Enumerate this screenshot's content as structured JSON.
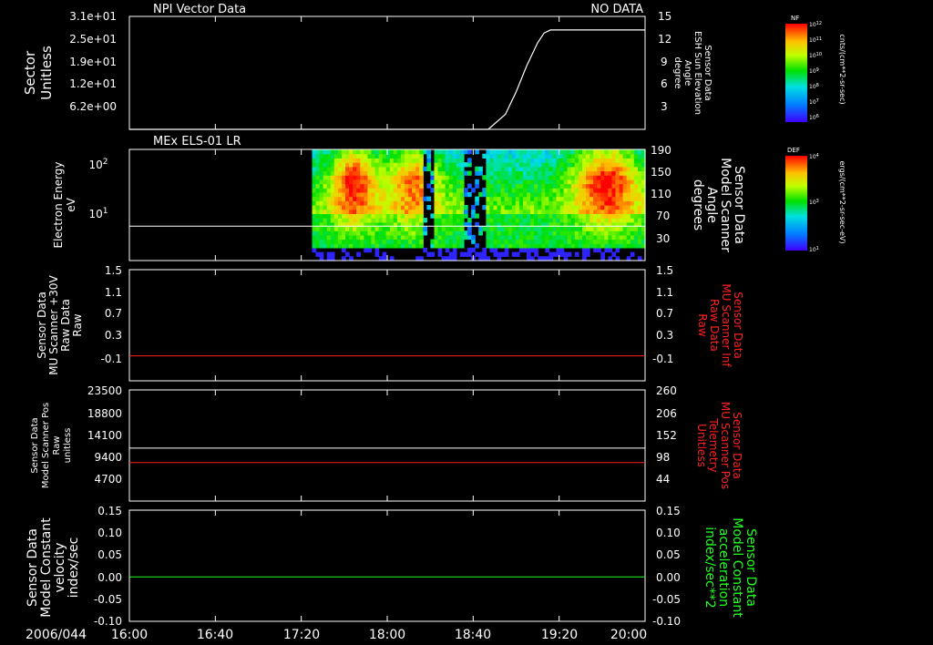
{
  "time_axis": {
    "date_label": "2006/044",
    "ticks": [
      "16:00",
      "16:40",
      "17:20",
      "18:00",
      "18:40",
      "19:20",
      "20:00"
    ]
  },
  "colors": {
    "background": "#000000",
    "foreground": "#ffffff",
    "red_trace": "#ff2020",
    "green_trace": "#20ff20",
    "white_trace": "#ffffff"
  },
  "colorbars": [
    {
      "name": "NF",
      "label": "NF",
      "unit_label": "cnts/(cm**2-sr-sec)",
      "tick_labels": [
        "10^12",
        "10^11",
        "10^10",
        "10^9",
        "10^8",
        "10^7",
        "10^6"
      ],
      "ticks": [
        {
          "mant": "10",
          "exp": "12"
        },
        {
          "mant": "10",
          "exp": "11"
        },
        {
          "mant": "10",
          "exp": "10"
        },
        {
          "mant": "10",
          "exp": "9"
        },
        {
          "mant": "10",
          "exp": "8"
        },
        {
          "mant": "10",
          "exp": "7"
        },
        {
          "mant": "10",
          "exp": "6"
        }
      ]
    },
    {
      "name": "DEF",
      "label": "DEF",
      "unit_label": "ergs/(cm**2-sr-sec-eV)",
      "tick_labels": [
        "10^4",
        "10^3",
        "10^1"
      ],
      "ticks": [
        {
          "mant": "10",
          "exp": "4"
        },
        {
          "mant": "10",
          "exp": "3"
        },
        {
          "mant": "10",
          "exp": "1"
        }
      ]
    }
  ],
  "chart_data": [
    {
      "type": "line",
      "title": "NPI Vector Data",
      "status_text": "NO DATA",
      "ylabel_left": [
        "Sector",
        "Unitless"
      ],
      "yticks_left": [
        "3.1e+01",
        "2.5e+01",
        "1.9e+01",
        "1.2e+01",
        "6.2e+00"
      ],
      "ylabel_right": [
        "Sensor Data",
        "ESH Sun Elevation",
        "Angle",
        "degree"
      ],
      "yticks_right": [
        "15",
        "12",
        "9",
        "6",
        "3"
      ],
      "ylim_right": [
        0,
        15
      ],
      "series": [
        {
          "color": "#ffffff",
          "axis": "right",
          "x": [
            "16:00",
            "18:47",
            "18:55",
            "19:00",
            "19:05",
            "19:10",
            "19:13",
            "19:16",
            "20:00"
          ],
          "values": [
            0,
            0,
            2,
            5,
            8.5,
            11.5,
            12.8,
            13.2,
            13.2
          ]
        }
      ]
    },
    {
      "type": "heatmap",
      "title": "MEx ELS-01 LR",
      "ylabel_left": [
        "Electron Energy",
        "eV"
      ],
      "ytick_left_labels": [
        "10^2",
        "10^1"
      ],
      "ylim_left": [
        4,
        180
      ],
      "ylog_left": true,
      "yticks_left": [
        {
          "mant": "10",
          "exp": "2",
          "value": 100
        },
        {
          "mant": "10",
          "exp": "1",
          "value": 10
        }
      ],
      "ylabel_right": [
        "Sensor Data",
        "Model Scanner",
        "Angle",
        "degrees"
      ],
      "yticks_right": [
        "190",
        "150",
        "110",
        "70",
        "30"
      ],
      "ylim_right": [
        0,
        190
      ],
      "data_coverage": [
        "17:25",
        "20:00"
      ],
      "horizontal_line": {
        "value_eV": 13,
        "color": "#ffffff"
      },
      "colorbar": "DEF"
    },
    {
      "type": "line",
      "ylabel_left": [
        "Sensor Data",
        "MU Scanner +30V",
        "Raw Data",
        "Raw"
      ],
      "yticks_left": [
        "1.5",
        "1.1",
        "0.7",
        "0.3",
        "-0.1"
      ],
      "ylim_left": [
        -0.5,
        1.5
      ],
      "ylabel_right": [
        "Sensor Data",
        "MU Scanner Inf",
        "Raw Data",
        "Raw"
      ],
      "yticks_right": [
        "1.5",
        "1.1",
        "0.7",
        "0.3",
        "-0.1"
      ],
      "series": [
        {
          "color": "#ff2020",
          "x": [
            "16:00",
            "20:00"
          ],
          "values": [
            -0.05,
            -0.05
          ]
        }
      ]
    },
    {
      "type": "line",
      "ylabel_left": [
        "Sensor Data",
        "Model Scanner Pos",
        "Raw",
        "unitless"
      ],
      "yticks_left": [
        "23500",
        "18800",
        "14100",
        "9400",
        "4700"
      ],
      "ylim_left": [
        0,
        23500
      ],
      "ylabel_right": [
        "Sensor Data",
        "MU Scanner Pos",
        "Telemetry",
        "Unitless"
      ],
      "yticks_right": [
        "260",
        "206",
        "152",
        "98",
        "44"
      ],
      "ylim_right": [
        -10,
        260
      ],
      "series": [
        {
          "color": "#ffffff",
          "axis": "left",
          "x": [
            "16:00",
            "20:00"
          ],
          "values": [
            11200,
            11200
          ]
        },
        {
          "color": "#ff2020",
          "axis": "left",
          "x": [
            "16:00",
            "20:00"
          ],
          "values": [
            8150,
            8150
          ]
        }
      ]
    },
    {
      "type": "line",
      "ylabel_left": [
        "Sensor Data",
        "Model Constant",
        "velocity",
        "index/sec"
      ],
      "yticks_left": [
        "0.15",
        "0.10",
        "0.05",
        "0.00",
        "-0.05",
        "-0.10"
      ],
      "ylim_left": [
        -0.1,
        0.15
      ],
      "ylabel_right": [
        "Sensor Data",
        "Model Constant",
        "acceleration",
        "index/sec**2"
      ],
      "yticks_right": [
        "0.15",
        "0.10",
        "0.05",
        "0.00",
        "-0.05",
        "-0.10"
      ],
      "series": [
        {
          "color": "#20ff20",
          "x": [
            "16:00",
            "20:00"
          ],
          "values": [
            0.0,
            0.0
          ]
        }
      ]
    }
  ]
}
